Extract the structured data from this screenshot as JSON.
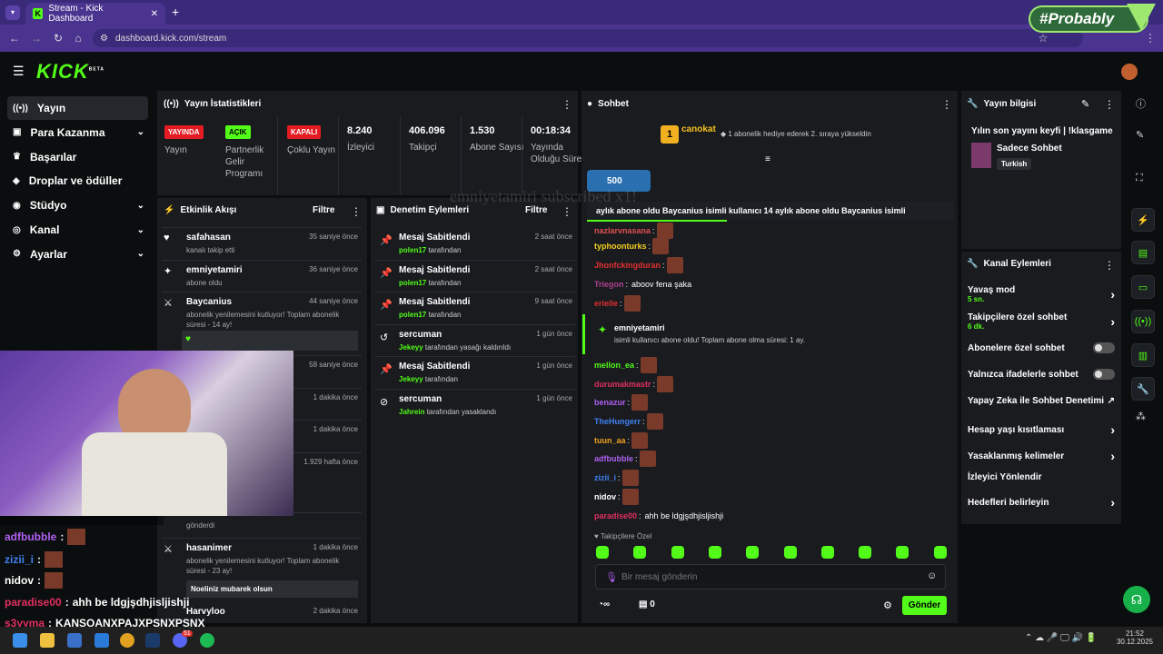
{
  "browser": {
    "tab_title": "Stream - Kick Dashboard",
    "url": "dashboard.kick.com/stream",
    "overlay_tag": "#Probably"
  },
  "logo": "KICK",
  "logo_badge": "BETA",
  "sidebar": [
    {
      "label": "Yayın",
      "icon": "stream-icon",
      "active": true
    },
    {
      "label": "Para Kazanma",
      "icon": "money-icon",
      "expand": true
    },
    {
      "label": "Başarılar",
      "icon": "trophy-icon"
    },
    {
      "label": "Droplar ve ödüller",
      "icon": "gift-icon"
    },
    {
      "label": "Stüdyo",
      "icon": "studio-icon",
      "expand": true
    },
    {
      "label": "Kanal",
      "icon": "channel-icon",
      "expand": true
    },
    {
      "label": "Ayarlar",
      "icon": "gear-icon",
      "expand": true
    }
  ],
  "stats": {
    "title": "Yayın İstatistikleri",
    "items": [
      {
        "badge": "YAYINDA",
        "label": "Yayın",
        "badge_color": "#e31b23"
      },
      {
        "badge": "AÇIK",
        "label": "Partnerlik Gelir Programı",
        "badge_color": "#53fc18"
      },
      {
        "badge": "KAPALI",
        "label": "Çoklu Yayın",
        "badge_color": "#e31b23"
      },
      {
        "value": "8.240",
        "label": "İzleyici"
      },
      {
        "value": "406.096",
        "label": "Takipçi"
      },
      {
        "value": "1.530",
        "label": "Abone Sayısı"
      },
      {
        "value": "00:18:34",
        "label": "Yayında Olduğu Süre"
      }
    ]
  },
  "activity": {
    "title": "Etkinlik Akışı",
    "filter": "Filtre",
    "items": [
      {
        "name": "safahasan",
        "sub": "kanalı takip etti",
        "time": "35 saniye önce",
        "icon": "heart-icon"
      },
      {
        "name": "emniyetamiri",
        "sub": "abone oldu",
        "time": "36 saniye önce",
        "icon": "star-icon"
      },
      {
        "name": "Baycanius",
        "sub": "abonelik yenilemesini kutluyor! Toplam abonelik süresi - 14 ay!",
        "time": "44 saniye önce",
        "icon": "sword-icon"
      },
      {
        "name": "",
        "sub": "",
        "time": "58 saniye önce"
      },
      {
        "name": "",
        "sub": "",
        "time": "1 dakika önce"
      },
      {
        "name": "",
        "sub": "",
        "time": "1 dakika önce"
      },
      {
        "name": "",
        "sub": "",
        "time": "1.929 hafta önce"
      },
      {
        "name": "",
        "sub": "gönderdi",
        "time": ""
      },
      {
        "name": "hasanimer",
        "sub": "abonelik yenilemesini kutluyor! Toplam abonelik süresi - 23 ay!",
        "time": "1 dakika önce",
        "icon": "sword-icon",
        "note": "Noeliniz mubarek olsun"
      },
      {
        "name": "Harvyloo",
        "sub": "",
        "time": "2 dakika önce"
      }
    ]
  },
  "moderation": {
    "title": "Denetim Eylemleri",
    "filter": "Filtre",
    "items": [
      {
        "name": "Mesaj Sabitlendi",
        "who": "polen17",
        "rest": "tarafından",
        "time": "2 saat önce",
        "icon": "pin-icon"
      },
      {
        "name": "Mesaj Sabitlendi",
        "who": "polen17",
        "rest": "tarafından",
        "time": "2 saat önce",
        "icon": "pin-icon"
      },
      {
        "name": "Mesaj Sabitlendi",
        "who": "polen17",
        "rest": "tarafından",
        "time": "9 saat önce",
        "icon": "pin-icon"
      },
      {
        "name": "sercuman",
        "who": "Jekeyy",
        "rest": "tarafından yasağı kaldırıldı",
        "time": "1 gün önce",
        "icon": "undo-icon"
      },
      {
        "name": "Mesaj Sabitlendi",
        "who": "Jekeyy",
        "rest": "tarafından",
        "time": "1 gün önce",
        "icon": "pin-icon"
      },
      {
        "name": "sercuman",
        "who": "Jahrein",
        "rest": "tarafından yasaklandı",
        "time": "1 gün önce",
        "icon": "ban-icon"
      }
    ]
  },
  "chat": {
    "title": "Sohbet",
    "top_gifter": "canokat",
    "top_gifter_count": "1",
    "gift_msg": "1 abonelik hediye ederek 2. sıraya yükseldin",
    "kicks": "500",
    "ticker": "aylık abone oldu   Baycanius isimli kullanıcı 14 aylık abone oldu   Baycanius isimli",
    "overlay_text": "emniyetamiri subscribed x1!",
    "messages": [
      {
        "user": "nazlarvnasana",
        "color": "#e05050",
        "text": ""
      },
      {
        "user": "typhoonturks",
        "color": "#f5d020",
        "text": ""
      },
      {
        "user": "Jhonfckingduran",
        "color": "#e03030",
        "text": ""
      },
      {
        "user": "Triegon",
        "color": "#b04090",
        "text": "aboov fena şaka"
      },
      {
        "user": "erielle",
        "color": "#e03030",
        "text": ""
      }
    ],
    "sub_event_user": "emniyetamiri",
    "sub_event_text": "isimli kullanıcı abone oldu! Toplam abone olma süresi: 1 ay.",
    "messages2": [
      {
        "user": "mellon_ea",
        "color": "#53fc18",
        "text": ""
      },
      {
        "user": "durumakmastr",
        "color": "#e03060",
        "text": ""
      },
      {
        "user": "benazur",
        "color": "#b060f0",
        "text": ""
      },
      {
        "user": "TheHungerr",
        "color": "#4080f0",
        "text": ""
      },
      {
        "user": "tuun_aa",
        "color": "#f0a020",
        "text": ""
      },
      {
        "user": "adfbubble",
        "color": "#b060f0",
        "text": ""
      },
      {
        "user": "zizii_i",
        "color": "#4080f0",
        "text": ""
      },
      {
        "user": "nidov",
        "color": "#ffffff",
        "text": ""
      },
      {
        "user": "paradise00",
        "color": "#e03060",
        "text": "ahh be ldgjşdhjisljishji"
      }
    ],
    "followers_only": "Takipçilere Özel",
    "input_placeholder": "Bir mesaj gönderin",
    "count": "0",
    "send": "Gönder"
  },
  "stream_info": {
    "title": "Yayın bilgisi",
    "stream_title": "Yılın son yayını keyfi | !klasgame",
    "category": "Sadece Sohbet",
    "tag": "Turkish"
  },
  "channel_actions": {
    "title": "Kanal Eylemleri",
    "items": [
      {
        "label": "Yavaş mod",
        "sub": "5 sn.",
        "type": "arrow"
      },
      {
        "label": "Takipçilere özel sohbet",
        "sub": "6 dk.",
        "type": "arrow"
      },
      {
        "label": "Abonelere özel sohbet",
        "sub": "",
        "type": "toggle"
      },
      {
        "label": "Yalnızca ifadelerle sohbet",
        "sub": "",
        "type": "toggle"
      },
      {
        "label": "Yapay Zeka ile Sohbet Denetimi",
        "sub": "",
        "type": "external"
      },
      {
        "label": "Hesap yaşı kısıtlaması",
        "sub": "",
        "type": "arrow"
      },
      {
        "label": "Yasaklanmış kelimeler",
        "sub": "",
        "type": "arrow"
      },
      {
        "label": "İzleyici Yönlendir",
        "sub": "",
        "type": "none"
      },
      {
        "label": "Hedefleri belirleyin",
        "sub": "",
        "type": "arrow"
      }
    ]
  },
  "stream_chat_overlay": [
    {
      "user": "adfbubble",
      "color": "#b060f0",
      "text": ""
    },
    {
      "user": "zizii_i",
      "color": "#4080f0",
      "text": ""
    },
    {
      "user": "nidov",
      "color": "#ffffff",
      "text": ""
    },
    {
      "user": "paradise00",
      "color": "#e03060",
      "text": "ahh be ldgjşdhjisljishji"
    },
    {
      "user": "s3yyma",
      "color": "#e03060",
      "text": "KANSOANXPAJXPSNXPSNX"
    }
  ],
  "taskbar": {
    "time": "21:52",
    "date": "30.12.2025",
    "discord_badge": "51"
  }
}
